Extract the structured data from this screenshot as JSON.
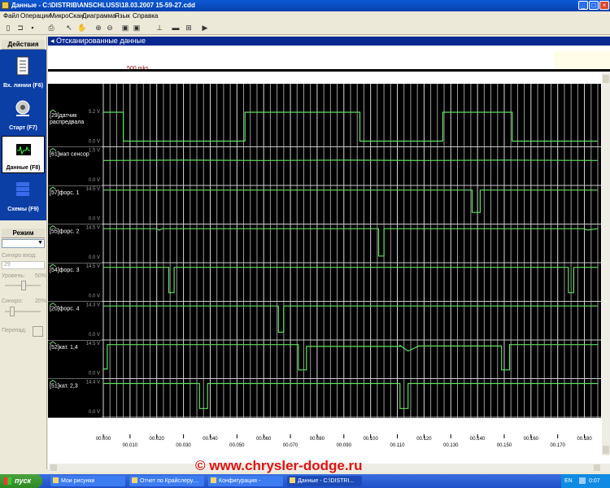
{
  "window": {
    "title": "Данные - C:\\DISTRIB\\ANSCHLUSS\\18.03.2007 15-59-27.cdd"
  },
  "menu": [
    "Файл",
    "Операции",
    "МикроСкан",
    "Диаграмма",
    "Язык",
    "Справка"
  ],
  "sidebar": {
    "actions_title": "Действия",
    "actions": [
      {
        "label": "Вх. линии (F6)",
        "icon": "input-lines-icon"
      },
      {
        "label": "Старт (F7)",
        "icon": "probe-start-icon"
      },
      {
        "label": "Данные (F8)",
        "icon": "waveform-data-icon"
      },
      {
        "label": "Схемы (F9)",
        "icon": "schemes-stack-icon"
      }
    ],
    "mode_title": "Режим",
    "mode_value": "",
    "sync_input_label": "Синхро вход:",
    "sync_input_value": "29",
    "level_label": "Уровень:",
    "level_value": "50%",
    "sync_label": "Синхро:",
    "sync_value": "20%",
    "drop_label": "Перепад:"
  },
  "panel": {
    "title": "Отсканированные данные",
    "scale_label": "500 mks"
  },
  "chart_data": {
    "type": "line",
    "title": "",
    "xlabel": "",
    "x_ticks": [
      "00.000",
      "00.010",
      "00.020",
      "00.030",
      "00.040",
      "00.050",
      "00.060",
      "00.070",
      "00.080",
      "00.090",
      "00.100",
      "00.110",
      "00.120",
      "00.130",
      "00.140",
      "00.150",
      "00.160",
      "00.170",
      "00.180"
    ],
    "x_range": [
      0,
      0.185
    ],
    "channels": [
      {
        "name": "[29]датчик распредвала",
        "max_label": "5.2 V",
        "min_label": "0.0 V",
        "range": [
          0,
          5.2
        ],
        "points": [
          [
            0,
            5.2
          ],
          [
            0.0075,
            5.2
          ],
          [
            0.0075,
            0
          ],
          [
            0.053,
            0
          ],
          [
            0.053,
            5.2
          ],
          [
            0.096,
            5.2
          ],
          [
            0.096,
            0
          ],
          [
            0.127,
            0
          ],
          [
            0.127,
            5.2
          ],
          [
            0.153,
            5.2
          ],
          [
            0.153,
            0
          ],
          [
            0.185,
            0
          ]
        ]
      },
      {
        "name": "[61]мап сенсор",
        "max_label": "1.5 V",
        "min_label": "0.0 V",
        "range": [
          0,
          1.5
        ],
        "points": [
          [
            0,
            1.0
          ],
          [
            0.03,
            1.02
          ],
          [
            0.06,
            1.0
          ],
          [
            0.09,
            1.02
          ],
          [
            0.12,
            1.0
          ],
          [
            0.15,
            1.02
          ],
          [
            0.185,
            1.0
          ]
        ]
      },
      {
        "name": "[57]форс. 1",
        "max_label": "14.5 V",
        "min_label": "0.0 V",
        "range": [
          0,
          14.5
        ],
        "points": [
          [
            0,
            14.2
          ],
          [
            0.138,
            14.2
          ],
          [
            0.138,
            3
          ],
          [
            0.141,
            3
          ],
          [
            0.141,
            14.2
          ],
          [
            0.185,
            14.2
          ]
        ]
      },
      {
        "name": "[55]форс. 2",
        "max_label": "14.5 V",
        "min_label": "0.0 V",
        "range": [
          0,
          14.5
        ],
        "points": [
          [
            0,
            14.2
          ],
          [
            0.02,
            14.2
          ],
          [
            0.021,
            13.5
          ],
          [
            0.022,
            14.2
          ],
          [
            0.103,
            14.2
          ],
          [
            0.103,
            0.5
          ],
          [
            0.105,
            0.5
          ],
          [
            0.105,
            14.2
          ],
          [
            0.18,
            14.2
          ],
          [
            0.181,
            13.5
          ],
          [
            0.185,
            14.2
          ]
        ]
      },
      {
        "name": "[54]форс. 3",
        "max_label": "14.5 V",
        "min_label": "0.0 V",
        "range": [
          0,
          14.5
        ],
        "points": [
          [
            0,
            14.2
          ],
          [
            0.0245,
            14.2
          ],
          [
            0.0245,
            1.5
          ],
          [
            0.0265,
            1.5
          ],
          [
            0.0265,
            14.2
          ],
          [
            0.174,
            14.2
          ],
          [
            0.174,
            1.5
          ],
          [
            0.176,
            1.5
          ],
          [
            0.176,
            14.2
          ],
          [
            0.185,
            14.2
          ]
        ]
      },
      {
        "name": "[20]форс. 4",
        "max_label": "14.3 V",
        "min_label": "0.0 V",
        "range": [
          0,
          14.3
        ],
        "points": [
          [
            0,
            14.0
          ],
          [
            0.0655,
            14.0
          ],
          [
            0.0655,
            1.0
          ],
          [
            0.0675,
            1.0
          ],
          [
            0.0675,
            14.0
          ],
          [
            0.185,
            14.0
          ]
        ]
      },
      {
        "name": "[52]кат. 1,4",
        "max_label": "14.5 V",
        "min_label": "0.0 V",
        "range": [
          0,
          14.5
        ],
        "points": [
          [
            0,
            2
          ],
          [
            0.0015,
            2
          ],
          [
            0.0015,
            14.2
          ],
          [
            0.073,
            14.2
          ],
          [
            0.073,
            1.5
          ],
          [
            0.076,
            1.5
          ],
          [
            0.076,
            13.3
          ],
          [
            0.111,
            13.3
          ],
          [
            0.111,
            13.8
          ],
          [
            0.114,
            11
          ],
          [
            0.118,
            13.5
          ],
          [
            0.149,
            13.5
          ],
          [
            0.149,
            1.5
          ],
          [
            0.152,
            1.5
          ],
          [
            0.152,
            14.2
          ],
          [
            0.185,
            14.2
          ]
        ]
      },
      {
        "name": "[51]кат. 2,3",
        "max_label": "14.4 V",
        "min_label": "0.0 V",
        "range": [
          0,
          14.4
        ],
        "points": [
          [
            0,
            14.0
          ],
          [
            0.036,
            14.0
          ],
          [
            0.036,
            1.5
          ],
          [
            0.039,
            1.5
          ],
          [
            0.039,
            14.0
          ],
          [
            0.111,
            14.0
          ],
          [
            0.111,
            1.5
          ],
          [
            0.114,
            1.5
          ],
          [
            0.114,
            14.0
          ],
          [
            0.185,
            14.0
          ]
        ]
      }
    ]
  },
  "taskbar": {
    "start_label": "пуск",
    "tasks": [
      "Мои рисунки",
      "Отчет по Крайслеру....",
      "Конфигурация -",
      "Данные - C:\\DISTRI..."
    ],
    "lang": "EN",
    "time": "0:07"
  },
  "watermark": "© www.chrysler-dodge.ru"
}
